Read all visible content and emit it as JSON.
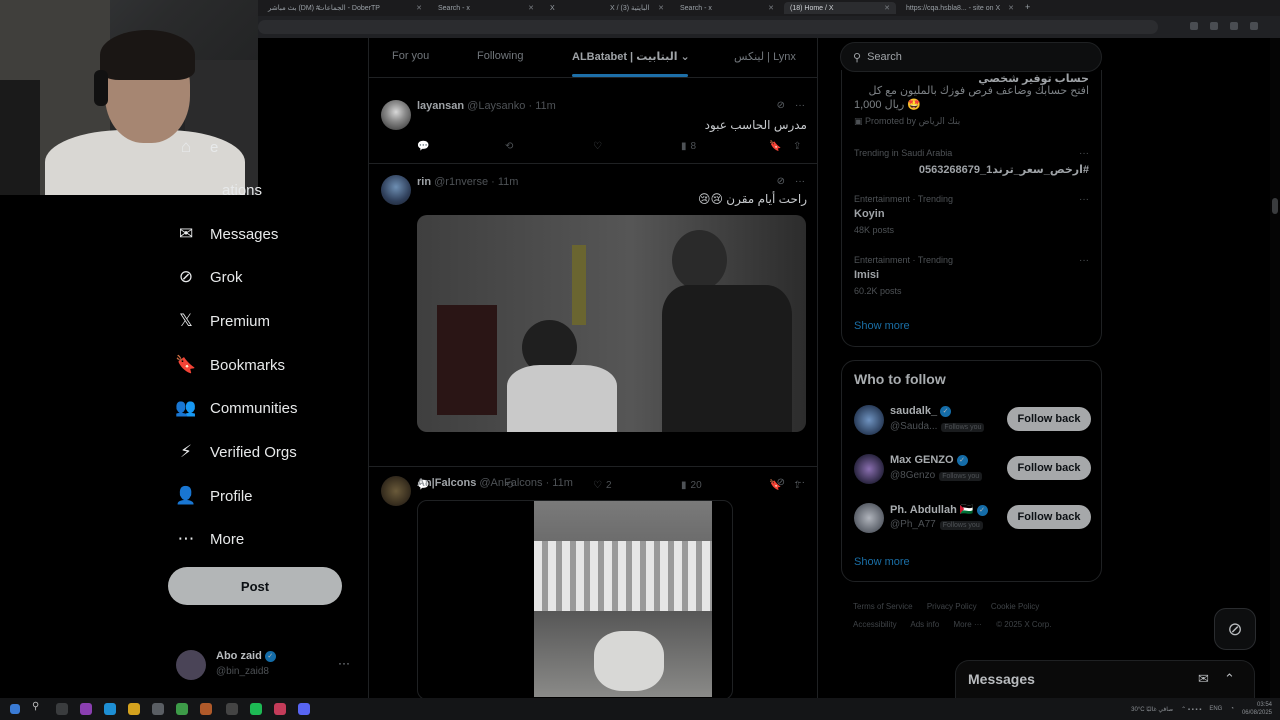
{
  "browser": {
    "tabs": [
      {
        "label": "بث مباشر (DM) #",
        "active": false
      },
      {
        "label": "الجماعات - DoberTP",
        "active": false
      },
      {
        "label": "Search - x",
        "active": false
      },
      {
        "label": "X",
        "active": false
      },
      {
        "label": "X / البايتية (3)",
        "active": false
      },
      {
        "label": "Search - x",
        "active": false
      },
      {
        "label": "(18) Home / X",
        "active": true
      },
      {
        "label": "https://cqa.hsbla8... - site on X",
        "active": false
      }
    ],
    "new_tab": "+"
  },
  "nav": {
    "items": [
      {
        "label": "Home",
        "icon": "home-icon",
        "glyph": "⌂"
      },
      {
        "label": "Notifications",
        "icon": "bell-icon",
        "glyph": "🔔"
      },
      {
        "label": "Messages",
        "icon": "envelope-icon",
        "glyph": "✉"
      },
      {
        "label": "Grok",
        "icon": "grok-icon",
        "glyph": "⊘"
      },
      {
        "label": "Premium",
        "icon": "x-logo-icon",
        "glyph": "𝕏"
      },
      {
        "label": "Bookmarks",
        "icon": "bookmark-icon",
        "glyph": "🔖"
      },
      {
        "label": "Communities",
        "icon": "communities-icon",
        "glyph": "👥"
      },
      {
        "label": "Verified Orgs",
        "icon": "lightning-icon",
        "glyph": "⚡"
      },
      {
        "label": "Profile",
        "icon": "person-icon",
        "glyph": "👤"
      },
      {
        "label": "More",
        "icon": "more-circle-icon",
        "glyph": "⋯"
      }
    ],
    "visible_labels": {
      "home": "e",
      "notifications": "ations",
      "messages": "Messages",
      "grok": "Grok",
      "premium": "Premium",
      "bookmarks": "Bookmarks",
      "communities": "Communities",
      "verified_orgs": "Verified Orgs",
      "profile": "Profile",
      "more": "More"
    },
    "post_button": "Post",
    "account": {
      "name": "Abo zaid",
      "handle": "@bin_zaid8",
      "more": "···"
    }
  },
  "feed": {
    "tabs": [
      "For you",
      "Following",
      "ALBatabet | البتابيت",
      "لينكس | Lynx"
    ],
    "active_tab": "ALBatabet | البتابيت",
    "posts": [
      {
        "name": "layansan",
        "handle": "@Laysanko",
        "time": "· 11m",
        "text": "مدرس الحاسب عبود",
        "replies": "",
        "reposts": "",
        "likes": "",
        "views": "8"
      },
      {
        "name": "rin",
        "handle": "@r1nverse",
        "time": "· 11m",
        "text": "راحت أيام مقرن 😢😢",
        "replies": "",
        "reposts": "",
        "likes": "2",
        "views": "20"
      },
      {
        "name": "An|Falcons",
        "handle": "@AnFalcons",
        "time": "· 11m",
        "text": "",
        "replies": "",
        "reposts": "",
        "likes": "",
        "views": ""
      }
    ]
  },
  "sidebar": {
    "search_placeholder": "Search",
    "promo": {
      "line1": "حساب توفير شخصي",
      "line2": "افتح حسابك وضاعف فرص فوزك بالمليون مع كل",
      "line3": "1,000 ريال 🤩",
      "promoted": "Promoted by بنك الرياض"
    },
    "trends": [
      {
        "context": "Trending in Saudi Arabia",
        "title": "#ارخص_سعر_ترند1_0563268679",
        "rtl": true,
        "posts": ""
      },
      {
        "context": "Entertainment · Trending",
        "title": "Koyin",
        "rtl": false,
        "posts": "48K posts"
      },
      {
        "context": "Entertainment · Trending",
        "title": "Imisi",
        "rtl": false,
        "posts": "60.2K posts"
      }
    ],
    "trends_show_more": "Show more",
    "who_to_follow": {
      "title": "Who to follow",
      "users": [
        {
          "name": "saudalk_",
          "handle": "@Sauda...",
          "follows_you": "Follows you",
          "button": "Follow back",
          "color": "#3a5f8a"
        },
        {
          "name": "Max GENZO",
          "handle": "@8Genzo",
          "follows_you": "Follows you",
          "button": "Follow back",
          "color": "#4a3a6a"
        },
        {
          "name": "Ph. Abdullah 🇵🇸",
          "handle": "@Ph_A77",
          "follows_you": "Follows you",
          "button": "Follow back",
          "color": "#7a7f88"
        }
      ],
      "show_more": "Show more"
    },
    "footer": [
      "Terms of Service",
      "Privacy Policy",
      "Cookie Policy",
      "Accessibility",
      "Ads info",
      "More ···",
      "© 2025 X Corp."
    ]
  },
  "messages_drawer": {
    "title": "Messages"
  },
  "taskbar": {
    "weather": "30°C صافي غالبًا",
    "lang": "ENG",
    "time": "03:54",
    "date": "06/08/2025"
  }
}
